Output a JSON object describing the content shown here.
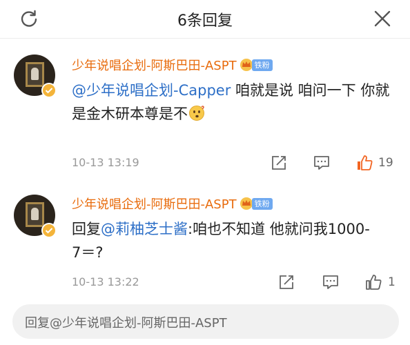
{
  "header": {
    "title": "6条回复"
  },
  "comments": [
    {
      "username": "少年说唱企划-阿斯巴田-ASPT",
      "fan_badge": "铁粉",
      "mention": "@少年说唱企划-Capper",
      "text": " 咱就是说 咱问一下 你就是金木研本尊是不",
      "emoji_icon": "thinking-face-emoji",
      "time": "10-13 13:19",
      "likes": "19",
      "liked": true
    },
    {
      "username": "少年说唱企划-阿斯巴田-ASPT",
      "fan_badge": "铁粉",
      "prefix": "回复",
      "mention": "@莉柚芝士酱",
      "text": ":咱也不知道 他就问我1000-7＝?",
      "time": "10-13 13:22",
      "likes": "1",
      "liked": false
    }
  ],
  "reply_input": {
    "placeholder": "回复@少年说唱企划-阿斯巴田-ASPT"
  },
  "colors": {
    "username": "#e86b0c",
    "mention": "#2d6fc7",
    "like_active": "#f26522",
    "fan_badge": "#6fa9f0",
    "verified": "#f4b43a"
  }
}
